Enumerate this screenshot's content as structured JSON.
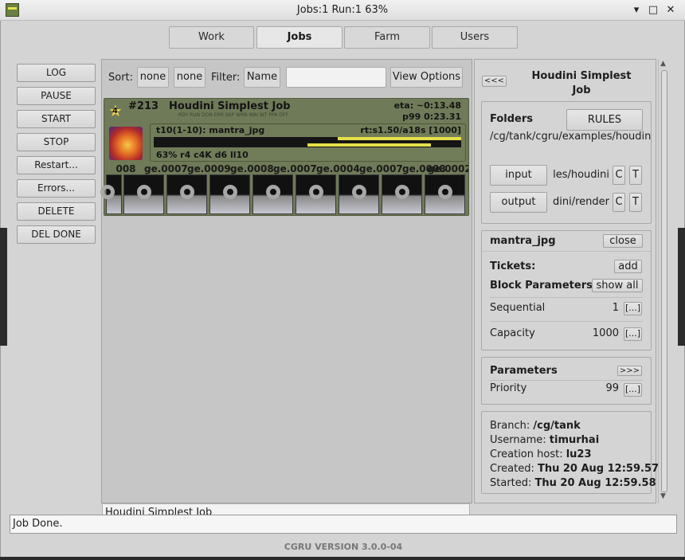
{
  "window": {
    "title": "Jobs:1 Run:1 63%",
    "icon": "cgru-icon",
    "controls": [
      "minimize-icon",
      "maximize-icon",
      "close-icon"
    ]
  },
  "tabs": [
    {
      "label": "Work",
      "active": false
    },
    {
      "label": "Jobs",
      "active": true
    },
    {
      "label": "Farm",
      "active": false
    },
    {
      "label": "Users",
      "active": false
    }
  ],
  "actions": [
    "LOG",
    "PAUSE",
    "START",
    "STOP",
    "Restart...",
    "Errors...",
    "DELETE",
    "DEL DONE"
  ],
  "toolbar": {
    "sort_label": "Sort:",
    "sort1": "none",
    "sort2": "none",
    "filter_label": "Filter:",
    "filter_field": "Name",
    "filter_value": "",
    "view_options": "View Options"
  },
  "job": {
    "priority_badge": "4",
    "id": "#213",
    "name": "Houdini Simplest Job",
    "eta": "eta: ~0:13.48",
    "p99": "p99 0:23.31",
    "state_flags": "RDY RUN DON ERR SKP WRN WAI WT PPA OFF",
    "block": {
      "title": "t10(1-10): mantra_jpg",
      "rt": "rt:s1.50/a18s [1000]",
      "summary": "63% r4 c4K d6 ll10",
      "progress_percent": 63
    },
    "thumbnails": [
      "008",
      "ge.0007",
      "ge.0009",
      "ge.0008",
      "ge.0007",
      "ge.0004",
      "ge.0007",
      "ge.0008",
      "ge.0002"
    ]
  },
  "selected_job_name": "Houdini Simplest Job",
  "details": {
    "collapse": "<<<",
    "title": "Houdini Simplest Job",
    "folders_label": "Folders",
    "rules": "RULES",
    "folder_path": "/cg/tank/cgru/examples/houdin",
    "input_label": "input",
    "input_path": "les/houdini",
    "output_label": "output",
    "output_path": "dini/render",
    "c": "C",
    "t": "T",
    "block_name": "mantra_jpg",
    "close": "close",
    "tickets_label": "Tickets:",
    "add": "add",
    "block_params_label": "Block Parameters",
    "show_all": "show all",
    "sequential_label": "Sequential",
    "sequential_value": "1",
    "capacity_label": "Capacity",
    "capacity_value": "1000",
    "edit": "[...]",
    "parameters_label": "Parameters",
    "expand": ">>>",
    "priority_label": "Priority",
    "priority_value": "99",
    "branch_label": "Branch:",
    "branch": "/cg/tank",
    "username_label": "Username:",
    "username": "timurhai",
    "host_label": "Creation host:",
    "host": "lu23",
    "created_label": "Created:",
    "created": "Thu 20 Aug 12:59.57",
    "started_label": "Started:",
    "started": "Thu 20 Aug 12:59.58"
  },
  "status": "Job Done.",
  "version": "CGRU VERSION 3.0.0-04",
  "colors": {
    "job_bg": "#6f7a58",
    "progress": "#e4e04a",
    "bar_dark": "#141414"
  }
}
